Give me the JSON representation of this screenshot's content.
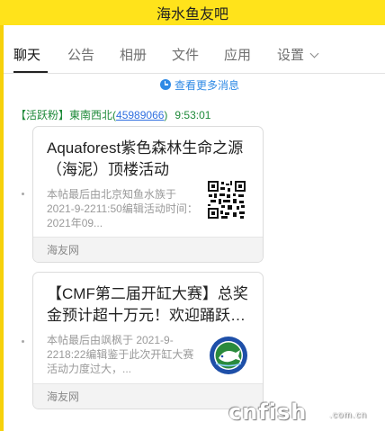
{
  "window": {
    "title": "海水鱼友吧"
  },
  "tabs": [
    {
      "label": "聊天",
      "active": true
    },
    {
      "label": "公告",
      "active": false
    },
    {
      "label": "相册",
      "active": false
    },
    {
      "label": "文件",
      "active": false
    },
    {
      "label": "应用",
      "active": false
    },
    {
      "label": "设置",
      "active": false,
      "has_dropdown": true
    }
  ],
  "chat": {
    "load_more": {
      "icon": "clock-icon",
      "label": "查看更多消息"
    },
    "sender": {
      "tag": "【活跃粉】",
      "name": "東南西北",
      "qq_open": "(",
      "qq": "45989066",
      "qq_close": ")",
      "time": "9:53:01"
    },
    "messages": [
      {
        "title": "Aquaforest紫色森林生命之源（海泥）顶楼活动",
        "desc": "本帖最后由北京知鱼水族于 2021-9-2211:50编辑活动时间：2021年09...",
        "source": "海友网",
        "thumb": "qr-code-image"
      },
      {
        "title": "【CMF第二届开缸大赛】总奖金预计超十万元！欢迎踊跃参加！",
        "desc": "本帖最后由飒枫于 2021-9-2218:22编辑鉴于此次开缸大赛活动力度过大，...",
        "source": "海友网",
        "thumb": "contest-badge-image"
      }
    ]
  },
  "watermark": {
    "text": "cnfish",
    "sub": ".com.cn"
  },
  "colors": {
    "titlebar": "#ffe31b",
    "link": "#2f8ae5",
    "sender": "#1f8a3a",
    "qq_link": "#2f6fe0"
  }
}
